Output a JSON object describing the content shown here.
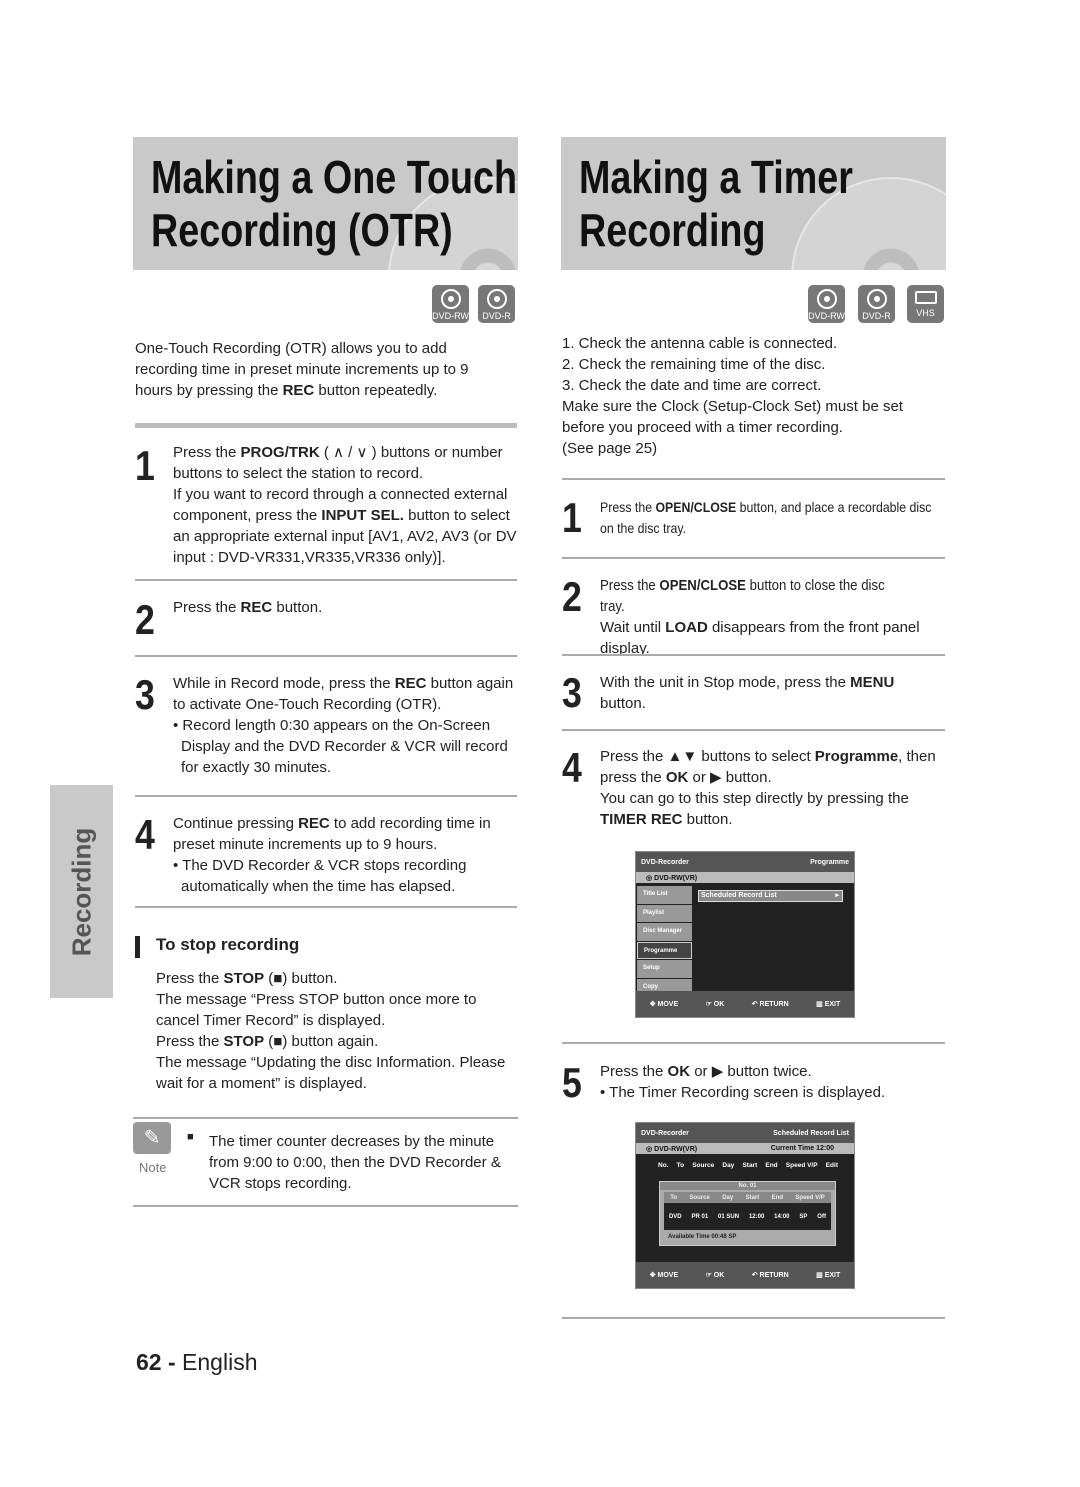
{
  "left": {
    "title": [
      "Making a One Touch",
      "Recording (OTR)"
    ],
    "badges": [
      "DVD-RW",
      "DVD-R"
    ],
    "intro": [
      [
        "One-Touch Recording (OTR) allows you to add recording time in preset minute increments up to 9 hours by pressing the ",
        0
      ],
      [
        "REC",
        1
      ],
      [
        " button repeatedly.",
        0
      ]
    ],
    "steps": [
      {
        "num": "1",
        "text": [
          [
            "Press the ",
            0
          ],
          [
            "PROG/TRK",
            1
          ],
          [
            " ( ∧ / ∨ ) buttons or number buttons to select the station to record.",
            0
          ]
        ],
        "extra": [
          [
            "If you want to record through a connected external component, press the ",
            0
          ],
          [
            "INPUT SEL.",
            1
          ],
          [
            " button to select an appropriate external input [AV1, AV2, AV3 (or DV input : DVD-VR331,VR335,VR336 only)].",
            0
          ]
        ]
      },
      {
        "num": "2",
        "text": [
          [
            "Press the ",
            0
          ],
          [
            "REC",
            1
          ],
          [
            " button.",
            0
          ]
        ]
      },
      {
        "num": "3",
        "text": [
          [
            "While in Record mode, press the ",
            0
          ],
          [
            "REC",
            1
          ],
          [
            " button again to activate One-Touch Recording (OTR).",
            0
          ]
        ],
        "bullet": "Record length 0:30 appears on the On-Screen Display and the DVD Recorder & VCR will record for exactly 30 minutes."
      },
      {
        "num": "4",
        "text": [
          [
            "Continue pressing ",
            0
          ],
          [
            "REC",
            1
          ],
          [
            " to add recording time in preset minute increments up to 9 hours.",
            0
          ]
        ],
        "bullet": "The DVD Recorder & VCR stops recording automatically when the time has elapsed."
      }
    ],
    "stop": {
      "heading": "To stop recording",
      "body": [
        [
          "Press the ",
          0
        ],
        [
          "STOP",
          1
        ],
        [
          " (■) button.\nThe message “Press STOP button once more to cancel Timer Record” is displayed.\nPress the ",
          0
        ],
        [
          "STOP",
          1
        ],
        [
          " (■) button again.\nThe message “Updating the disc Information. Please wait for a moment” is displayed.",
          0
        ]
      ]
    },
    "note": {
      "label": "Note",
      "text": "The timer counter decreases by the minute from 9:00 to 0:00, then the DVD Recorder & VCR stops recording."
    },
    "side_tab": "Recording",
    "footer": {
      "page": "62",
      "sep": "-",
      "lang": "English"
    }
  },
  "right": {
    "title": [
      "Making a Timer",
      "Recording"
    ],
    "badges": [
      "DVD-RW",
      "DVD-R",
      "VHS"
    ],
    "intro": "1. Check the antenna cable is connected.\n2. Check the remaining time of the disc.\n3. Check the date and time are correct.\nMake sure the Clock (Setup-Clock Set) must be set before you proceed with a timer recording.\n (See page 25)",
    "steps": [
      {
        "num": "1",
        "text": [
          [
            "Press the ",
            0
          ],
          [
            "OPEN/CLOSE",
            1
          ],
          [
            " button, and place a recordable disc on the disc tray.",
            0
          ]
        ]
      },
      {
        "num": "2",
        "text": [
          [
            "Press the ",
            0
          ],
          [
            "OPEN/CLOSE",
            1
          ],
          [
            " button to close the disc tray.",
            0
          ]
        ],
        "extra": [
          [
            "Wait until ",
            0
          ],
          [
            "LOAD",
            1
          ],
          [
            " disappears from the front panel display.",
            0
          ]
        ]
      },
      {
        "num": "3",
        "text": [
          [
            "With the unit in Stop mode, press the ",
            0
          ],
          [
            "MENU",
            1
          ],
          [
            " button.",
            0
          ]
        ]
      },
      {
        "num": "4",
        "text": [
          [
            "Press the ▲▼ buttons to select ",
            0
          ],
          [
            "Programme",
            1
          ],
          [
            ", then press the ",
            0
          ],
          [
            "OK",
            1
          ],
          [
            " or ▶ button.",
            0
          ]
        ],
        "extra": [
          [
            "You can go to this step directly by pressing the ",
            0
          ],
          [
            "TIMER REC",
            1
          ],
          [
            " button.",
            0
          ]
        ]
      },
      {
        "num": "5",
        "text": [
          [
            "Press the ",
            0
          ],
          [
            "OK",
            1
          ],
          [
            " or ▶ button twice.",
            0
          ]
        ],
        "bullet": "The Timer Recording screen is displayed."
      }
    ],
    "screen1": {
      "app": "DVD-Recorder",
      "section": "Programme",
      "disc": "DVD-RW(VR)",
      "menu": [
        "Title List",
        "Playlist",
        "Disc Manager",
        "Programme",
        "Setup",
        "Copy"
      ],
      "item": "Scheduled Record List",
      "footer": [
        "MOVE",
        "OK",
        "RETURN",
        "EXIT"
      ]
    },
    "screen2": {
      "app": "DVD-Recorder",
      "section": "Scheduled Record List",
      "disc": "DVD-RW(VR)",
      "current_time": "Current Time  12:00",
      "columns": [
        "No.",
        "To",
        "Source",
        "Day",
        "Start",
        "End",
        "Speed V/P",
        "Edit"
      ],
      "box_title": "No. 01",
      "box_cols": [
        "To",
        "Source",
        "Day",
        "Start",
        "End",
        "Speed V/P"
      ],
      "values": [
        "DVD",
        "PR 01",
        "01 SUN",
        "12:00",
        "14:00",
        "SP",
        "Off"
      ],
      "available": "Available Time    00:48   SP",
      "footer": [
        "MOVE",
        "OK",
        "RETURN",
        "EXIT"
      ]
    }
  }
}
